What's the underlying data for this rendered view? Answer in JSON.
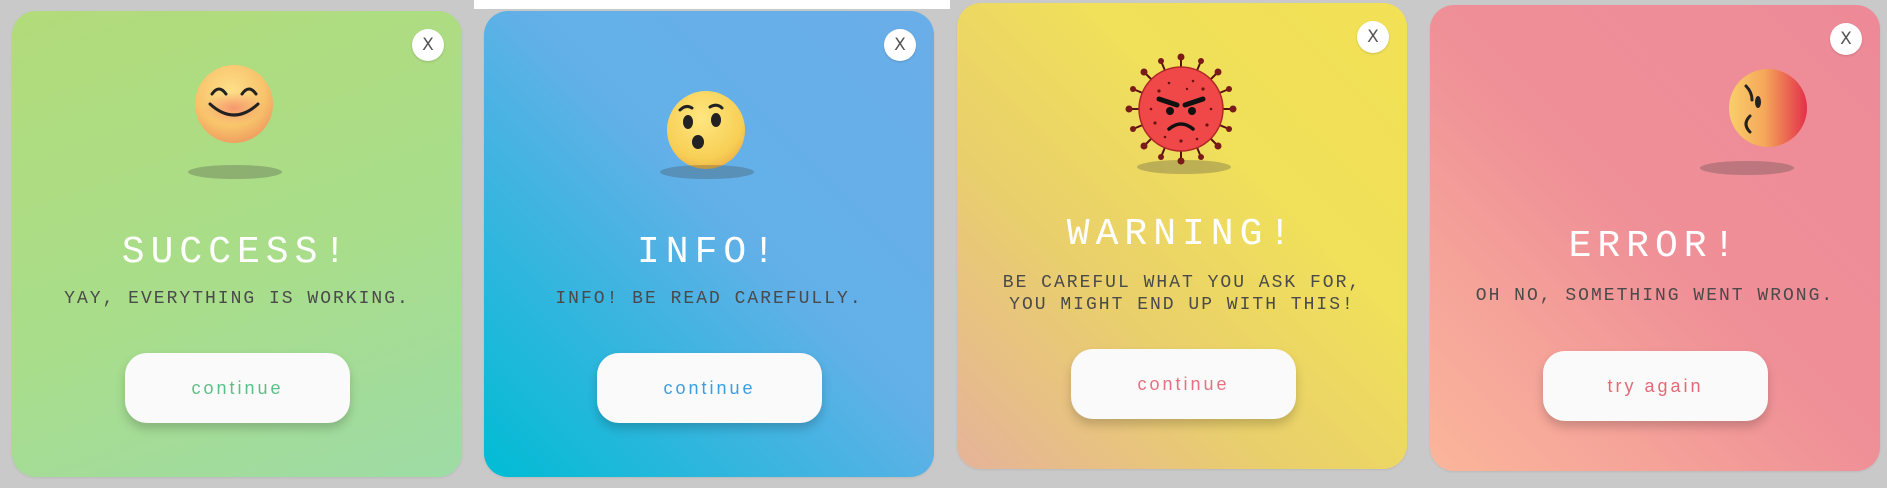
{
  "cards": [
    {
      "type": "success",
      "close_label": "X",
      "emoji_icon": "smiling-face-icon",
      "title": "SUCCESS!",
      "message": "YAY, EVERYTHING IS WORKING.",
      "button_label": "continue",
      "accent": "#b2db7a"
    },
    {
      "type": "info",
      "close_label": "X",
      "emoji_icon": "surprised-face-icon",
      "title": "INFO!",
      "message": "INFO! BE READ CAREFULLY.",
      "button_label": "continue",
      "accent": "#6aaee9"
    },
    {
      "type": "warning",
      "close_label": "X",
      "emoji_icon": "angry-virus-icon",
      "title": "WARNING!",
      "message_line1": "BE CAREFUL WHAT YOU ASK FOR,",
      "message_line2": "YOU MIGHT END UP WITH THIS!",
      "button_label": "continue",
      "accent": "#f0e05a"
    },
    {
      "type": "error",
      "close_label": "X",
      "emoji_icon": "sad-face-icon",
      "title": "ERROR!",
      "message": "OH NO, SOMETHING WENT WRONG.",
      "button_label": "try again",
      "accent": "#ee8a98"
    }
  ]
}
